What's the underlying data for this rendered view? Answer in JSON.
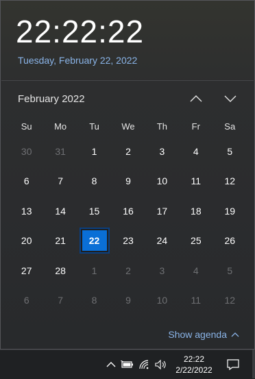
{
  "clock": {
    "time": "22:22:22",
    "date_link": "Tuesday, February 22, 2022"
  },
  "calendar": {
    "month_label": "February 2022",
    "weekdays": [
      "Su",
      "Mo",
      "Tu",
      "We",
      "Th",
      "Fr",
      "Sa"
    ],
    "weeks": [
      [
        {
          "d": "30",
          "dim": true
        },
        {
          "d": "31",
          "dim": true
        },
        {
          "d": "1"
        },
        {
          "d": "2"
        },
        {
          "d": "3"
        },
        {
          "d": "4"
        },
        {
          "d": "5"
        }
      ],
      [
        {
          "d": "6"
        },
        {
          "d": "7"
        },
        {
          "d": "8"
        },
        {
          "d": "9"
        },
        {
          "d": "10"
        },
        {
          "d": "11"
        },
        {
          "d": "12"
        }
      ],
      [
        {
          "d": "13"
        },
        {
          "d": "14"
        },
        {
          "d": "15"
        },
        {
          "d": "16"
        },
        {
          "d": "17"
        },
        {
          "d": "18"
        },
        {
          "d": "19"
        }
      ],
      [
        {
          "d": "20"
        },
        {
          "d": "21"
        },
        {
          "d": "22",
          "today": true
        },
        {
          "d": "23"
        },
        {
          "d": "24"
        },
        {
          "d": "25"
        },
        {
          "d": "26"
        }
      ],
      [
        {
          "d": "27"
        },
        {
          "d": "28"
        },
        {
          "d": "1",
          "dim": true
        },
        {
          "d": "2",
          "dim": true
        },
        {
          "d": "3",
          "dim": true
        },
        {
          "d": "4",
          "dim": true
        },
        {
          "d": "5",
          "dim": true
        }
      ],
      [
        {
          "d": "6",
          "dim": true
        },
        {
          "d": "7",
          "dim": true
        },
        {
          "d": "8",
          "dim": true
        },
        {
          "d": "9",
          "dim": true
        },
        {
          "d": "10",
          "dim": true
        },
        {
          "d": "11",
          "dim": true
        },
        {
          "d": "12",
          "dim": true
        }
      ]
    ]
  },
  "agenda": {
    "label": "Show agenda"
  },
  "taskbar": {
    "time": "22:22",
    "date": "2/22/2022",
    "icons": [
      "chevron-up-icon",
      "battery-icon",
      "wifi-icon",
      "volume-icon",
      "notification-icon"
    ]
  },
  "colors": {
    "accent": "#0a6fd6",
    "link": "#8ab4e8",
    "dim_text": "#6f7073"
  }
}
